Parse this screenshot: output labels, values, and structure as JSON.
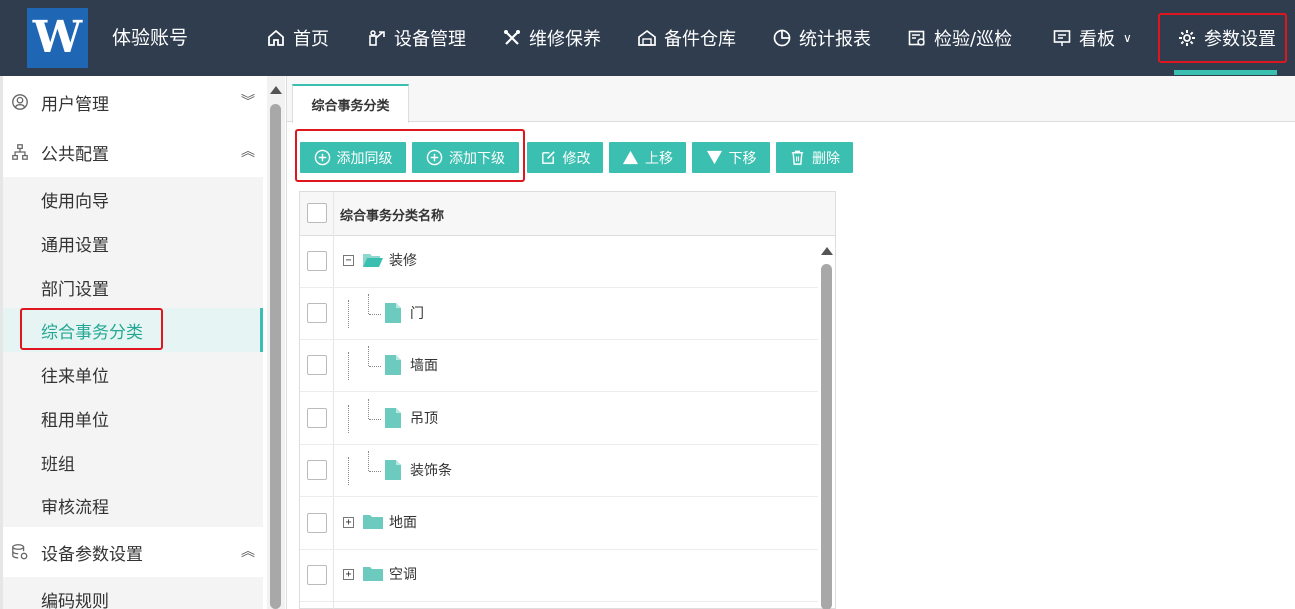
{
  "header": {
    "logo_text": "W",
    "account": "体验账号",
    "nav": [
      {
        "label": "首页",
        "icon": "home-icon"
      },
      {
        "label": "设备管理",
        "icon": "equipment-icon"
      },
      {
        "label": "维修保养",
        "icon": "tools-icon"
      },
      {
        "label": "备件仓库",
        "icon": "warehouse-icon"
      },
      {
        "label": "统计报表",
        "icon": "pie-chart-icon"
      },
      {
        "label": "检验/巡检",
        "icon": "inspection-icon"
      },
      {
        "label": "看板",
        "icon": "board-icon"
      },
      {
        "label": "参数设置",
        "icon": "gear-icon",
        "active": true
      }
    ]
  },
  "sidebar": {
    "groups": [
      {
        "label": "用户管理",
        "icon": "user-circle-icon",
        "expanded": false
      },
      {
        "label": "公共配置",
        "icon": "org-chart-icon",
        "expanded": true,
        "items": [
          "使用向导",
          "通用设置",
          "部门设置",
          "综合事务分类",
          "往来单位",
          "租用单位",
          "班组",
          "审核流程"
        ]
      },
      {
        "label": "设备参数设置",
        "icon": "database-gear-icon",
        "expanded": true,
        "items": [
          "编码规则"
        ]
      }
    ],
    "active_item": "综合事务分类"
  },
  "main": {
    "tab_label": "综合事务分类",
    "toolbar": {
      "add_sibling": "添加同级",
      "add_child": "添加下级",
      "edit": "修改",
      "move_up": "上移",
      "move_down": "下移",
      "delete": "删除"
    },
    "grid": {
      "column_header": "综合事务分类名称",
      "rows": [
        {
          "label": "装修",
          "type": "folder-open",
          "level": 0
        },
        {
          "label": "门",
          "type": "file",
          "level": 1
        },
        {
          "label": "墙面",
          "type": "file",
          "level": 1
        },
        {
          "label": "吊顶",
          "type": "file",
          "level": 1
        },
        {
          "label": "装饰条",
          "type": "file",
          "level": 1,
          "last": true
        },
        {
          "label": "地面",
          "type": "folder",
          "level": 0,
          "collapsed": true
        },
        {
          "label": "空调",
          "type": "folder",
          "level": 0,
          "collapsed": true
        }
      ]
    }
  },
  "colors": {
    "topbar": "#2f3d4f",
    "accent": "#3bbfb0",
    "logo_bg": "#1f67b5",
    "highlight_red": "#e0161f"
  }
}
